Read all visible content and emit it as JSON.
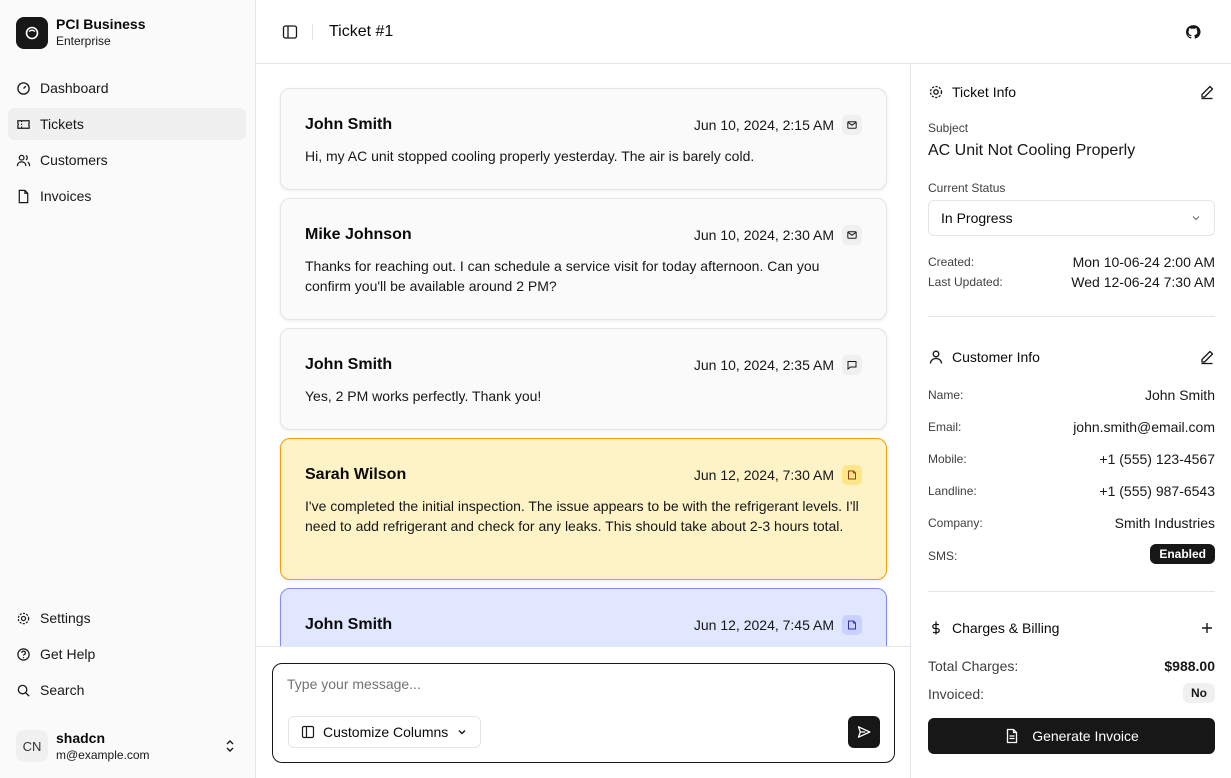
{
  "brand": {
    "name": "PCI Business",
    "plan": "Enterprise"
  },
  "nav": {
    "items": [
      {
        "label": "Dashboard",
        "icon": "gauge-icon"
      },
      {
        "label": "Tickets",
        "icon": "ticket-icon",
        "active": true
      },
      {
        "label": "Customers",
        "icon": "users-icon"
      },
      {
        "label": "Invoices",
        "icon": "file-icon"
      }
    ],
    "bottom": [
      {
        "label": "Settings",
        "icon": "gear-icon"
      },
      {
        "label": "Get Help",
        "icon": "help-icon"
      },
      {
        "label": "Search",
        "icon": "search-icon"
      }
    ]
  },
  "user": {
    "initials": "CN",
    "name": "shadcn",
    "email": "m@example.com"
  },
  "header": {
    "title": "Ticket #1"
  },
  "messages": [
    {
      "author": "John Smith",
      "time": "Jun 10, 2024, 2:15 AM",
      "icon": "mail-icon",
      "variant": "default",
      "text": "Hi, my AC unit stopped cooling properly yesterday. The air is barely cold."
    },
    {
      "author": "Mike Johnson",
      "time": "Jun 10, 2024, 2:30 AM",
      "icon": "mail-icon",
      "variant": "default",
      "text": "Thanks for reaching out. I can schedule a service visit for today afternoon. Can you confirm you'll be available around 2 PM?"
    },
    {
      "author": "John Smith",
      "time": "Jun 10, 2024, 2:35 AM",
      "icon": "chat-icon",
      "variant": "default",
      "text": "Yes, 2 PM works perfectly. Thank you!"
    },
    {
      "author": "Sarah Wilson",
      "time": "Jun 12, 2024, 7:30 AM",
      "icon": "note-icon",
      "variant": "yellow",
      "text": "I've completed the initial inspection. The issue appears to be with the refrigerant levels. I'll need to add refrigerant and check for any leaks. This should take about 2-3 hours total."
    },
    {
      "author": "John Smith",
      "time": "Jun 12, 2024, 7:45 AM",
      "icon": "note-icon",
      "variant": "blue",
      "text": ""
    }
  ],
  "composer": {
    "placeholder": "Type your message...",
    "customize_label": "Customize Columns"
  },
  "ticket_info": {
    "heading": "Ticket Info",
    "subject_label": "Subject",
    "subject": "AC Unit Not Cooling Properly",
    "status_label": "Current Status",
    "status": "In Progress",
    "created_label": "Created:",
    "created": "Mon 10-06-24 2:00 AM",
    "updated_label": "Last Updated:",
    "updated": "Wed 12-06-24 7:30 AM"
  },
  "customer_info": {
    "heading": "Customer Info",
    "rows": [
      {
        "label": "Name:",
        "value": "John Smith"
      },
      {
        "label": "Email:",
        "value": "john.smith@email.com"
      },
      {
        "label": "Mobile:",
        "value": "+1 (555) 123-4567"
      },
      {
        "label": "Landline:",
        "value": "+1 (555) 987-6543"
      },
      {
        "label": "Company:",
        "value": "Smith Industries"
      }
    ],
    "sms_label": "SMS:",
    "sms_value": "Enabled"
  },
  "billing": {
    "heading": "Charges & Billing",
    "total_label": "Total Charges:",
    "total": "$988.00",
    "invoiced_label": "Invoiced:",
    "invoiced": "No",
    "generate_label": "Generate Invoice"
  }
}
